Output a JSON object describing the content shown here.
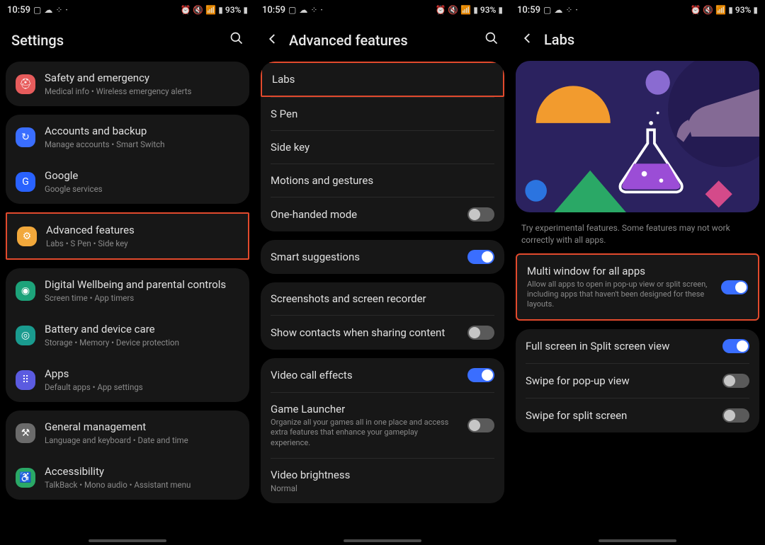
{
  "status": {
    "time": "10:59",
    "battery": "93%"
  },
  "panel1": {
    "title": "Settings",
    "items": [
      {
        "title": "Safety and emergency",
        "sub": "Medical info  •  Wireless emergency alerts"
      },
      {
        "title": "Accounts and backup",
        "sub": "Manage accounts  •  Smart Switch"
      },
      {
        "title": "Google",
        "sub": "Google services"
      },
      {
        "title": "Advanced features",
        "sub": "Labs  •  S Pen  •  Side key"
      },
      {
        "title": "Digital Wellbeing and parental controls",
        "sub": "Screen time  •  App timers"
      },
      {
        "title": "Battery and device care",
        "sub": "Storage  •  Memory  •  Device protection"
      },
      {
        "title": "Apps",
        "sub": "Default apps  •  App settings"
      },
      {
        "title": "General management",
        "sub": "Language and keyboard  •  Date and time"
      },
      {
        "title": "Accessibility",
        "sub": "TalkBack  •  Mono audio  •  Assistant menu"
      }
    ]
  },
  "panel2": {
    "title": "Advanced features",
    "groups": {
      "g1": [
        {
          "title": "Labs"
        },
        {
          "title": "S Pen"
        },
        {
          "title": "Side key"
        },
        {
          "title": "Motions and gestures"
        },
        {
          "title": "One-handed mode",
          "toggle": false
        }
      ],
      "g2": [
        {
          "title": "Smart suggestions",
          "toggle": true
        }
      ],
      "g3": [
        {
          "title": "Screenshots and screen recorder"
        },
        {
          "title": "Show contacts when sharing content",
          "toggle": false
        }
      ],
      "g4": [
        {
          "title": "Video call effects",
          "toggle": true
        },
        {
          "title": "Game Launcher",
          "sub": "Organize all your games all in one place and access extra features that enhance your gameplay experience.",
          "toggle": false
        },
        {
          "title": "Video brightness",
          "sub": "Normal"
        }
      ]
    }
  },
  "panel3": {
    "title": "Labs",
    "desc": "Try experimental features. Some features may not work correctly with all apps.",
    "items": [
      {
        "title": "Multi window for all apps",
        "sub": "Allow all apps to open in pop-up view or split screen, including apps that haven't been designed for these layouts.",
        "toggle": true
      },
      {
        "title": "Full screen in Split screen view",
        "toggle": true
      },
      {
        "title": "Swipe for pop-up view",
        "toggle": false
      },
      {
        "title": "Swipe for split screen",
        "toggle": false
      }
    ]
  }
}
